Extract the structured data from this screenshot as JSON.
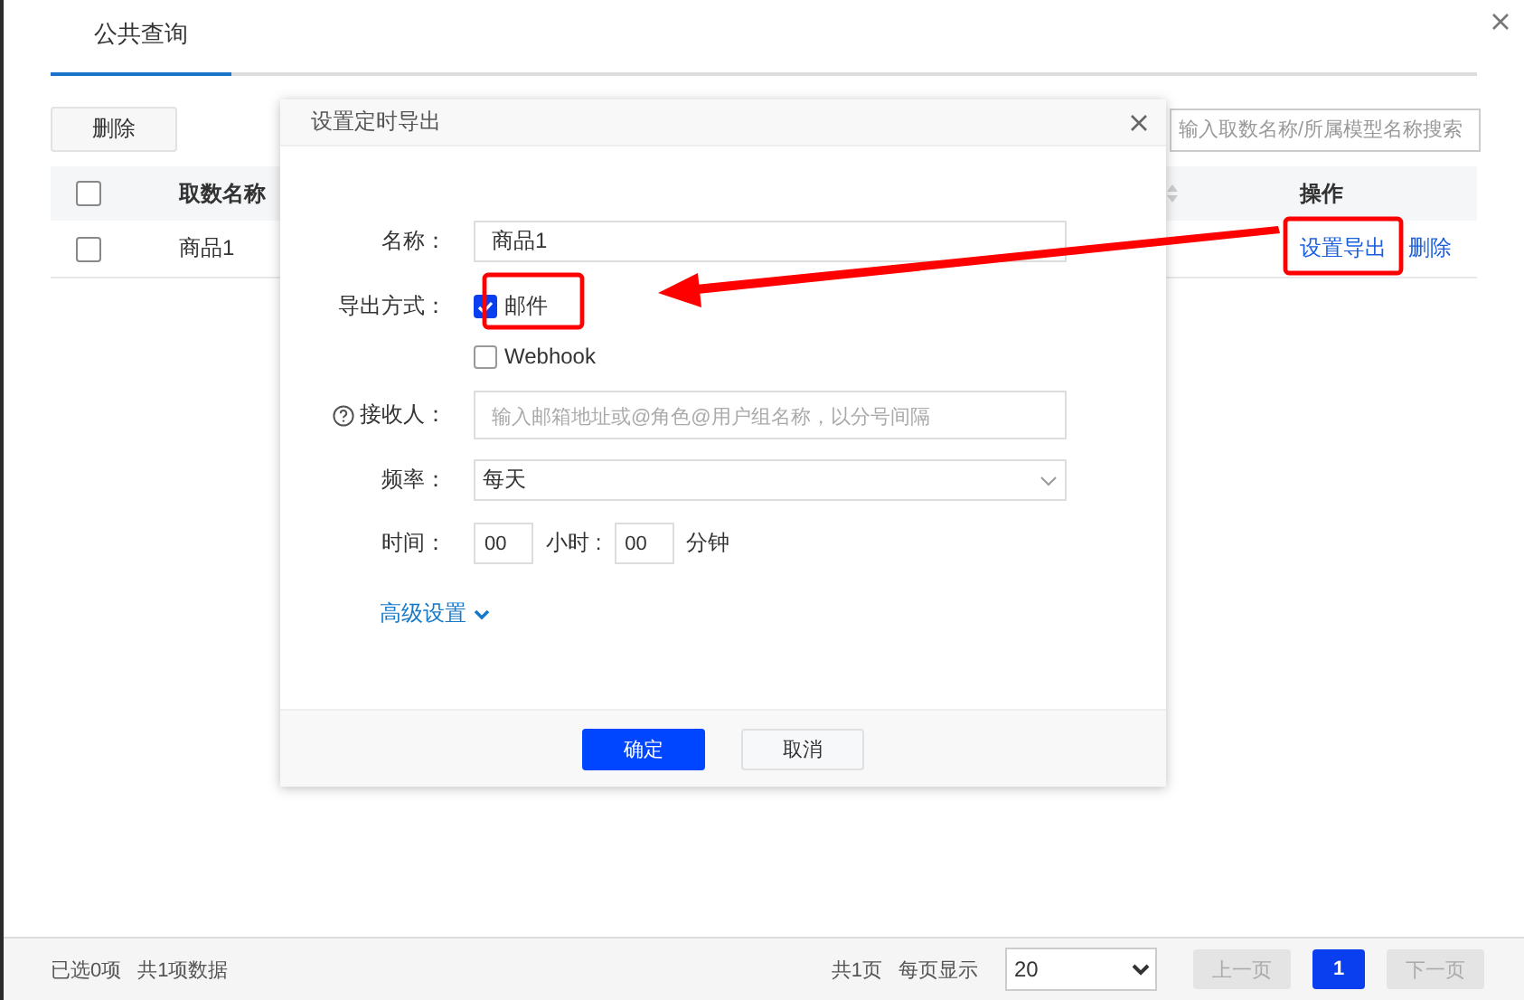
{
  "tabs": [
    {
      "label": "公共查询",
      "selected": true
    }
  ],
  "toolbar": {
    "delete_button": "删除",
    "search": {
      "placeholder": "输入取数名称/所属模型名称搜索"
    }
  },
  "table": {
    "header_checked": false,
    "columns": [
      {
        "label": "取数名称"
      },
      {
        "label": "操作"
      }
    ],
    "rows": [
      {
        "checked": false,
        "name": "商品1",
        "actions": [
          "设置导出",
          "删除"
        ]
      }
    ]
  },
  "dialog": {
    "title": "设置定时导出",
    "fields": [
      {
        "kind": "text",
        "label": "名称：",
        "value": "商品1"
      },
      {
        "kind": "checks",
        "label": "导出方式：",
        "options": [
          {
            "label": "邮件",
            "checked": true
          },
          {
            "label": "Webhook",
            "checked": false
          }
        ]
      },
      {
        "kind": "text",
        "label": "接收人：",
        "help": true,
        "placeholder": "输入邮箱地址或@角色@用户组名称，以分号间隔"
      },
      {
        "kind": "select",
        "label": "频率：",
        "value": "每天"
      },
      {
        "kind": "time",
        "label": "时间：",
        "hour": "00",
        "hour_unit": "小时 :",
        "minute": "00",
        "minute_unit": "分钟"
      }
    ],
    "advanced": "高级设置",
    "buttons": [
      {
        "label": "确定",
        "primary": true
      },
      {
        "label": "取消",
        "primary": false
      }
    ]
  },
  "footer": {
    "selected": "已选0项",
    "total": "共1项数据",
    "page_count": "共1页",
    "per_page_label": "每页显示",
    "per_page": "20",
    "prev": {
      "label": "上一页",
      "disabled": true
    },
    "pages": [
      {
        "label": "1",
        "selected": true
      }
    ],
    "next": {
      "label": "下一页",
      "disabled": true
    }
  }
}
